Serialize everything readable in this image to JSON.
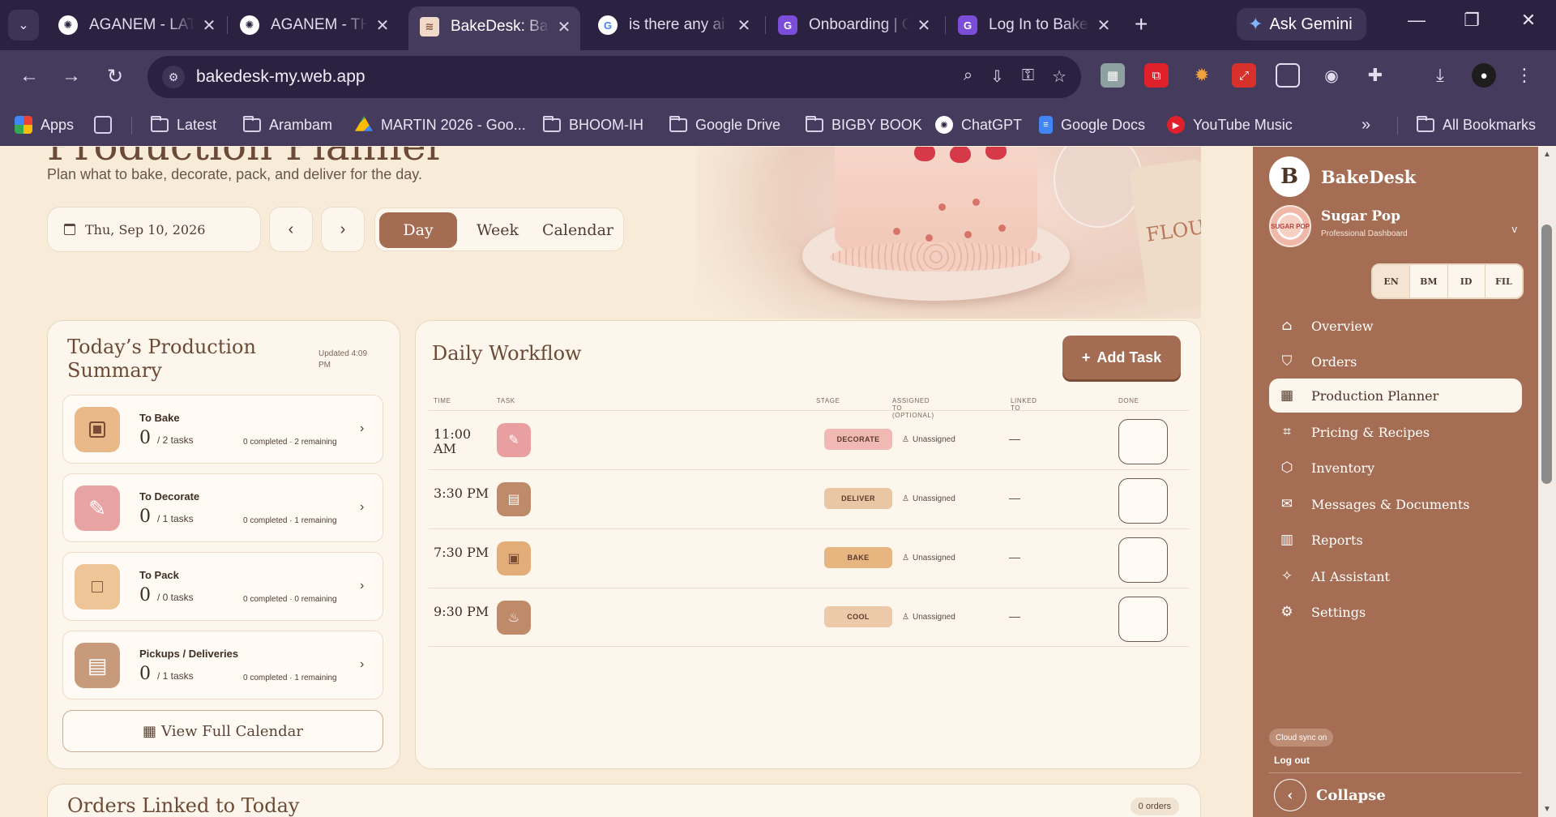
{
  "browser": {
    "tabs": [
      {
        "title": "AGANEM - LATEST",
        "icon": "chatgpt-icon"
      },
      {
        "title": "AGANEM - THE",
        "icon": "chatgpt-icon"
      },
      {
        "title": "BakeDesk: Bakery",
        "icon": "bakedesk-icon"
      },
      {
        "title": "is there any ai",
        "icon": "google-icon"
      },
      {
        "title": "Onboarding | G",
        "icon": "app-icon"
      },
      {
        "title": "Log In to Bake",
        "icon": "app-icon"
      }
    ],
    "gemini_label": "Ask Gemini",
    "url": "bakedesk-my.web.app",
    "bookmarks": [
      {
        "label": "Apps",
        "icon": "apps-icon"
      },
      {
        "label": "Latest",
        "icon": "folder-icon"
      },
      {
        "label": "Arambam",
        "icon": "folder-icon"
      },
      {
        "label": "MARTIN 2026 - Goo...",
        "icon": "google-drive-icon"
      },
      {
        "label": "BHOOM-IH",
        "icon": "folder-icon"
      },
      {
        "label": "Google Drive",
        "icon": "folder-icon"
      },
      {
        "label": "BIGBY BOOK",
        "icon": "folder-icon"
      },
      {
        "label": "ChatGPT",
        "icon": "chatgpt-icon"
      },
      {
        "label": "Google Docs",
        "icon": "docs-icon"
      },
      {
        "label": "YouTube Music",
        "icon": "youtube-music-icon"
      }
    ],
    "all_bookmarks": "All Bookmarks"
  },
  "page": {
    "title": "Production Planner",
    "subtitle": "Plan what to bake, decorate, pack, and deliver for the day.",
    "date": "Thu, Sep 10, 2026",
    "prev": "‹",
    "next": "›",
    "views": [
      "Day",
      "Week",
      "Calendar"
    ],
    "active_view": "Day"
  },
  "summary": {
    "title": "Today’s Production Summary",
    "updated": "Updated 4:09 PM",
    "items": [
      {
        "name": "To Bake",
        "count": "0",
        "tasks": "/ 2 tasks",
        "progress": "0 completed · 2 remaining",
        "color": "#e9b98a"
      },
      {
        "name": "To Decorate",
        "count": "0",
        "tasks": "/ 1 tasks",
        "progress": "0 completed · 1 remaining",
        "color": "#e8a3a3"
      },
      {
        "name": "To Pack",
        "count": "0",
        "tasks": "/ 0 tasks",
        "progress": "0 completed · 0 remaining",
        "color": "#edc596"
      },
      {
        "name": "Pickups / Deliveries",
        "count": "0",
        "tasks": "/ 1 tasks",
        "progress": "0 completed · 1 remaining",
        "color": "#c79a7c"
      }
    ],
    "view_calendar": "View Full Calendar"
  },
  "workflow": {
    "title": "Daily Workflow",
    "add_task": "Add Task",
    "columns": [
      "TIME",
      "TASK",
      "STAGE",
      "ASSIGNED TO (OPTIONAL)",
      "LINKED TO",
      "DONE"
    ],
    "rows": [
      {
        "time": "11:00 AM",
        "stage": "DECORATE",
        "stage_color": "#f0b9b3",
        "icon_color": "#e99ea0",
        "assigned": "Unassigned",
        "linked": "—"
      },
      {
        "time": "3:30 PM",
        "stage": "DELIVER",
        "stage_color": "#e9c7a5",
        "icon_color": "#bf8a69",
        "assigned": "Unassigned",
        "linked": "—"
      },
      {
        "time": "7:30 PM",
        "stage": "BAKE",
        "stage_color": "#e8b581",
        "icon_color": "#e2ad79",
        "assigned": "Unassigned",
        "linked": "—"
      },
      {
        "time": "9:30 PM",
        "stage": "COOL",
        "stage_color": "#ecc9a8",
        "icon_color": "#bf8a69",
        "assigned": "Unassigned",
        "linked": "—"
      }
    ]
  },
  "orders": {
    "title": "Orders Linked to Today",
    "badge": "0 orders"
  },
  "hero": {
    "flour_label": "FLOUR"
  },
  "sidebar": {
    "brand": "BakeDesk",
    "brand_initial": "B",
    "profile_name": "Sugar Pop",
    "profile_role": "Professional Dashboard",
    "avatar_text": "SUGAR POP",
    "chevron": "v",
    "languages": [
      "EN",
      "BM",
      "ID",
      "FIL"
    ],
    "nav": [
      {
        "label": "Overview",
        "icon": "home-icon"
      },
      {
        "label": "Orders",
        "icon": "bag-icon"
      },
      {
        "label": "Production Planner",
        "icon": "calendar-icon"
      },
      {
        "label": "Pricing & Recipes",
        "icon": "tag-icon"
      },
      {
        "label": "Inventory",
        "icon": "box-icon"
      },
      {
        "label": "Messages & Documents",
        "icon": "mail-icon"
      },
      {
        "label": "Reports",
        "icon": "bar-chart-icon"
      },
      {
        "label": "AI Assistant",
        "icon": "sparkle-icon"
      },
      {
        "label": "Settings",
        "icon": "gear-icon"
      }
    ],
    "active_nav": "Production Planner",
    "sync": "Cloud sync on",
    "logout": "Log out",
    "collapse": "Collapse"
  }
}
